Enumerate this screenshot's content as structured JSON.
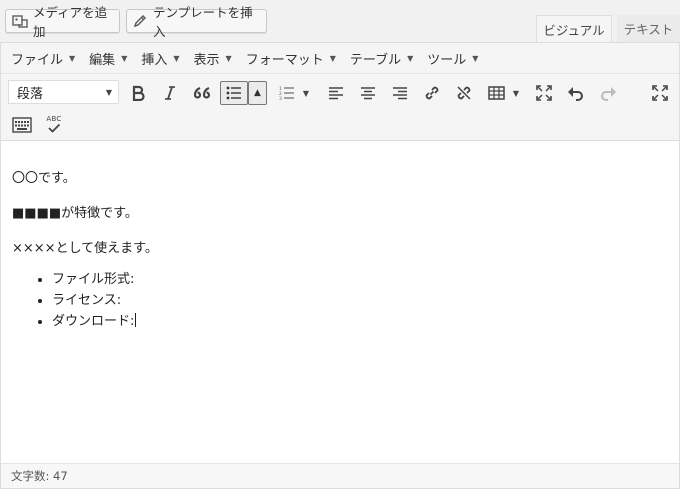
{
  "top_bar": {
    "add_media_label": "メディアを追加",
    "template_insert_label": "テンプレートを挿入",
    "tabs": [
      {
        "label": "ビジュアル",
        "active": true
      },
      {
        "label": "テキスト",
        "active": false
      }
    ]
  },
  "menubar": {
    "items": [
      {
        "label": "ファイル"
      },
      {
        "label": "編集"
      },
      {
        "label": "挿入"
      },
      {
        "label": "表示"
      },
      {
        "label": "フォーマット"
      },
      {
        "label": "テーブル"
      },
      {
        "label": "ツール"
      }
    ]
  },
  "toolbar": {
    "format_select_value": "段落",
    "icons": [
      "bold-icon",
      "italic-icon",
      "blockquote-icon",
      "bullet-list-icon",
      "numbered-list-icon",
      "align-left-icon",
      "align-center-icon",
      "align-right-icon",
      "link-icon",
      "unlink-icon",
      "table-icon",
      "fullscreen-icon",
      "undo-icon",
      "redo-icon",
      "distraction-free-icon",
      "keyboard-icon",
      "spellcheck-icon"
    ],
    "spellcheck_text": "ABC"
  },
  "content": {
    "paragraphs": [
      "〇〇です。",
      "■■■■が特徴です。",
      "××××として使えます。"
    ],
    "list_items": [
      "ファイル形式:",
      "ライセンス:",
      "ダウンロード:"
    ]
  },
  "status": {
    "word_count": "文字数: 47"
  },
  "colors": {
    "toolbar_bg": "#f5f5f5",
    "border": "#dddddd",
    "icon": "#444444"
  }
}
